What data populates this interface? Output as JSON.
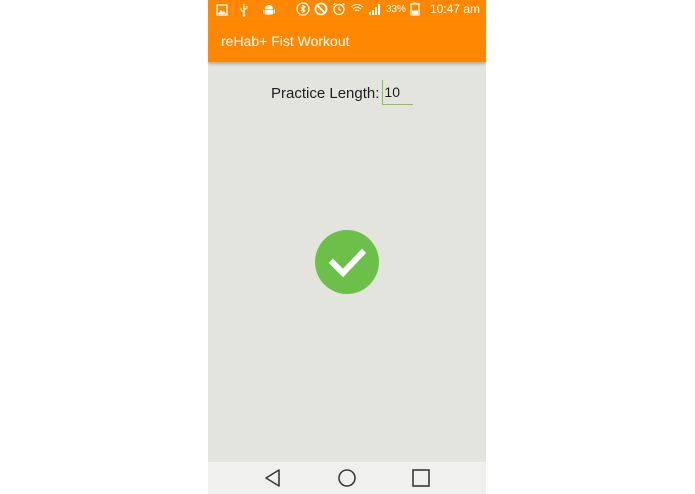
{
  "status_bar": {
    "battery_percent": "33%",
    "time": "10:47 am",
    "icons_left": [
      "image-icon",
      "usb-icon",
      "android-icon"
    ],
    "icons_right": [
      "bluetooth-icon",
      "do-not-disturb-icon",
      "alarm-icon",
      "wifi-icon",
      "signal-icon",
      "battery-icon"
    ]
  },
  "action_bar": {
    "title": "reHab+ Fist Workout",
    "color": "#ff8800"
  },
  "main": {
    "practice_label": "Practice Length:",
    "practice_value": "10",
    "check_button_color": "#6cc04a"
  },
  "nav_bar": {
    "buttons": [
      "back-icon",
      "home-icon",
      "recent-apps-icon"
    ]
  }
}
